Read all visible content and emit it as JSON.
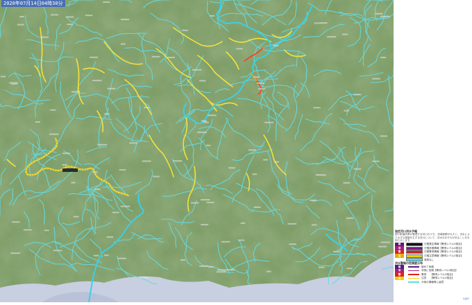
{
  "header": {
    "timestamp": "2020年07月14日04時30分"
  },
  "colors": {
    "land": "#7a9a63",
    "river_minor": "#66d9e0",
    "river_watch": "#f4e23a",
    "river_caution": "#ffd94d",
    "river_warning": "#ff3b20",
    "river_main": "#3ad0e8",
    "label_bg": "#1a1a1a",
    "sea": "#c8cfe0"
  },
  "legend": {
    "designated": {
      "title": "指定河川洪水予報",
      "note": "国や都道府県が管理する河川のうち、流域面積が大きく、洪水により大きな損害を生ずる河川について、洪水のおそれがあることをお知らせします。",
      "items": [
        {
          "level": "極",
          "level_color": "#5a1a78",
          "swatch": "#111111",
          "text": "氾濫発生情報【警戒レベル5相当】"
        },
        {
          "level": "非",
          "level_color": "#a02080",
          "swatch": "#7a1a8a",
          "text": "氾濫危険情報【警戒レベル4相当】"
        },
        {
          "level": "警",
          "level_color": "#e02020",
          "swatch": "#d02020",
          "text": "氾濫警戒情報【警戒レベル3相当】"
        },
        {
          "level": "注",
          "level_color": "#e0b000",
          "swatch": "#f0d000",
          "text": "氾濫注意情報【警戒レベル2相当】"
        },
        {
          "level": "",
          "level_color": "#ffffff",
          "swatch": "#5fd5e5",
          "text": "発表なし"
        }
      ]
    },
    "risk": {
      "title": "洪水警報の危険度分布",
      "items": [
        {
          "level": "極",
          "level_color": "#5a1a78",
          "line": "#5a1a78",
          "text": "極めて危険"
        },
        {
          "level": "非",
          "level_color": "#a02080",
          "line": "#a02080",
          "text": "非常に危険【警戒レベル4相当】"
        },
        {
          "level": "警",
          "level_color": "#e02020",
          "line": "#e02020",
          "text": "警戒　　【警戒レベル3相当】"
        },
        {
          "level": "注",
          "level_color": "#f0d000",
          "line": "#f0d000",
          "text": "注意　　【警戒レベル2相当】"
        },
        {
          "level": "",
          "level_color": "#ffffff",
          "line": "#66d9e0",
          "text": "今後の情報等に留意"
        }
      ]
    },
    "credit": "気象庁"
  }
}
